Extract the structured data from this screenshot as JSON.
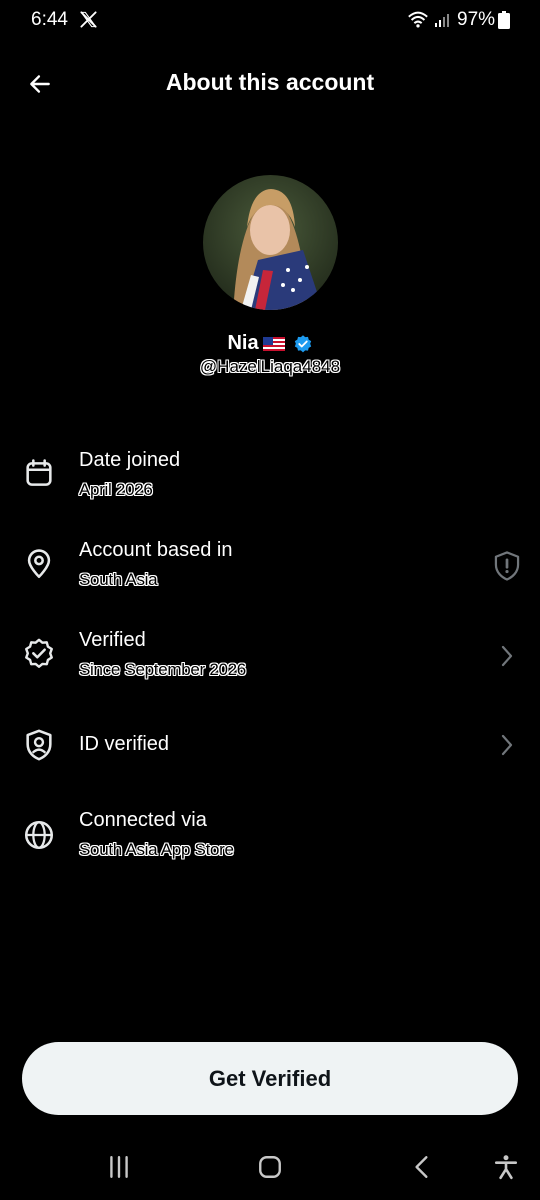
{
  "status_bar": {
    "time": "6:44",
    "battery": "97%",
    "icons": [
      "x-logo-icon",
      "wifi-icon",
      "signal-icon",
      "battery-icon"
    ]
  },
  "header": {
    "title": "About this account",
    "back_icon": "arrow-left-icon"
  },
  "profile": {
    "name": "Nia",
    "flag": "us-flag-icon",
    "handle": "@HazelLiaqa4848",
    "verified_badge": "verified-badge-icon",
    "avatar": "profile-photo"
  },
  "rows": [
    {
      "icon": "calendar-icon",
      "title": "Date joined",
      "value": "April 2026"
    },
    {
      "icon": "location-pin-icon",
      "title": "Account based in",
      "value": "South Asia",
      "trailing": "shield-alert-icon"
    },
    {
      "icon": "verified-seal-icon",
      "title": "Verified",
      "value": "Since September 2026",
      "trailing": "chevron-right-icon"
    },
    {
      "icon": "id-shield-icon",
      "title": "ID verified",
      "trailing": "chevron-right-icon"
    },
    {
      "icon": "globe-icon",
      "title": "Connected via",
      "value": "South Asia App Store"
    }
  ],
  "cta": {
    "label": "Get Verified"
  },
  "nav_bar": {
    "icons": [
      "recent-apps-icon",
      "home-icon",
      "back-icon",
      "accessibility-icon"
    ]
  },
  "colors": {
    "background": "#000000",
    "text": "#e7e9ea",
    "verified_blue": "#1d9bf0",
    "button_bg": "#eff3f4",
    "icon_gray": "#71767b"
  }
}
